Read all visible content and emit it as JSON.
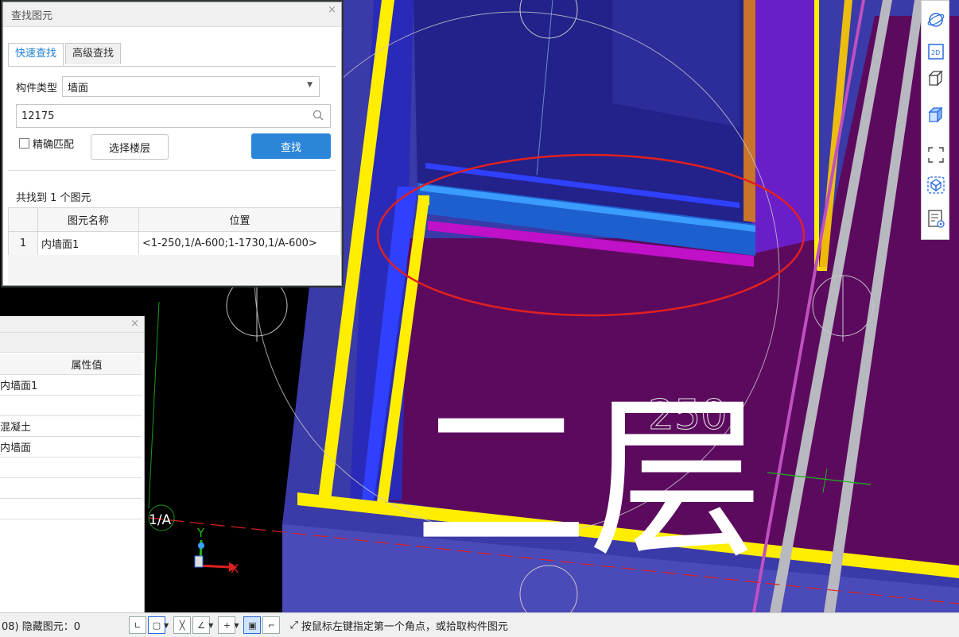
{
  "find_dialog": {
    "title": "查找图元",
    "close": "×",
    "tabs": [
      {
        "label": "快速查找",
        "active": true
      },
      {
        "label": "高级查找",
        "active": false
      }
    ],
    "component_type_label": "构件类型",
    "component_type_value": "墙面",
    "search_value": "12175",
    "exact_match_label": "精确匹配",
    "exact_match_checked": false,
    "select_floor_label": "选择楼层",
    "find_button_label": "查找",
    "result_count": "共找到 1 个图元",
    "columns": [
      "图元名称",
      "位置"
    ],
    "rows": [
      {
        "index": "1",
        "name": "内墙面1",
        "position": "<1-250,1/A-600;1-1730,1/A-600>"
      }
    ]
  },
  "property_panel": {
    "close": "×",
    "header": "属性值",
    "values": [
      "内墙面1",
      "",
      "混凝土",
      "内墙面",
      "",
      "",
      ""
    ]
  },
  "viewport": {
    "floor_label": "二层",
    "axis_label": "1/A",
    "dimension_text": "250",
    "axis_x": "X",
    "axis_y": "Y",
    "accent_colors": {
      "wall_purple": "#5c0a5e",
      "frame_yellow": "#ffee00",
      "highlight_red": "#e02020",
      "slab_blue": "#3a3aa8"
    }
  },
  "statusbar": {
    "left_text": "08) 隐藏图元：0",
    "hint": "按鼠标左键指定第一个角点，或拾取构件图元"
  },
  "right_toolbar": {
    "icons": [
      "orbit-icon",
      "2d-view-icon",
      "3d-box-icon",
      "3d-solid-icon",
      "fullscreen-icon",
      "view-cube-icon",
      "properties-icon"
    ],
    "label_2d": "2D"
  }
}
